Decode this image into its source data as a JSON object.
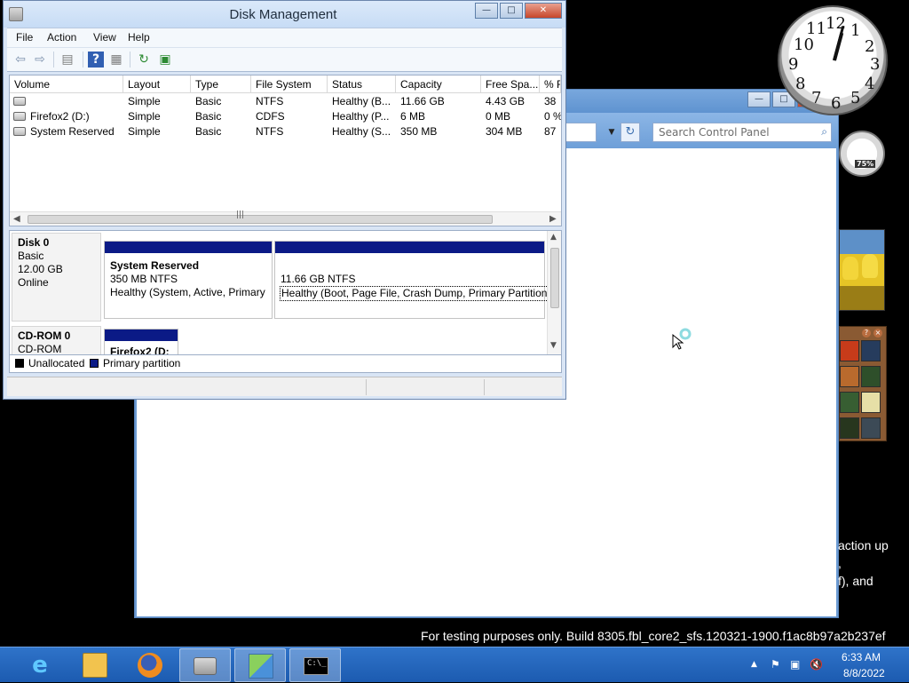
{
  "desktop": {
    "watermark": "For testing purposes only. Build 8305.fbl_core2_sfs.120321-1900.f1ac8b97a2b237ef",
    "overflow_text": [
      "action up",
      ",",
      "f), and"
    ],
    "clock_numbers": [
      "12",
      "1",
      "2",
      "3",
      "4",
      "5",
      "6",
      "7",
      "8",
      "9",
      "10",
      "11"
    ],
    "meter_value": "75%"
  },
  "control_panel": {
    "search_placeholder": "Search Control Panel",
    "title_buttons": [
      "—",
      "□",
      "✕"
    ]
  },
  "disk_management": {
    "title": "Disk Management",
    "menu": [
      "File",
      "Action",
      "View",
      "Help"
    ],
    "toolbar_icons": [
      "back-icon",
      "forward-icon",
      "console-tree-icon",
      "help-icon",
      "properties-icon",
      "refresh-icon",
      "export-icon"
    ],
    "columns": [
      "Volume",
      "Layout",
      "Type",
      "File System",
      "Status",
      "Capacity",
      "Free Spa...",
      "% F"
    ],
    "rows": [
      {
        "volume": "",
        "layout": "Simple",
        "type": "Basic",
        "fs": "NTFS",
        "status": "Healthy (B...",
        "capacity": "11.66 GB",
        "free": "4.43 GB",
        "pct": "38"
      },
      {
        "volume": "Firefox2 (D:)",
        "layout": "Simple",
        "type": "Basic",
        "fs": "CDFS",
        "status": "Healthy (P...",
        "capacity": "6 MB",
        "free": "0 MB",
        "pct": "0 %"
      },
      {
        "volume": "System Reserved",
        "layout": "Simple",
        "type": "Basic",
        "fs": "NTFS",
        "status": "Healthy (S...",
        "capacity": "350 MB",
        "free": "304 MB",
        "pct": "87"
      }
    ],
    "disks": [
      {
        "name": "Disk 0",
        "kind": "Basic",
        "size": "12.00 GB",
        "state": "Online",
        "partitions": [
          {
            "title": "System Reserved",
            "line1": "350 MB NTFS",
            "line2": "Healthy (System, Active, Primary"
          },
          {
            "title": "",
            "line1": "11.66 GB NTFS",
            "line2": "Healthy (Boot, Page File, Crash Dump, Primary Partition)"
          }
        ]
      },
      {
        "name": "CD-ROM 0",
        "kind": "CD-ROM",
        "partitions": [
          {
            "title": "Firefox2 (D:"
          }
        ]
      }
    ],
    "legend": [
      "Unallocated",
      "Primary partition"
    ],
    "colors": {
      "unallocated": "#000000",
      "primary": "#0b1a86"
    }
  },
  "taskbar": {
    "apps": [
      "internet-explorer-icon",
      "file-explorer-icon",
      "firefox-icon",
      "disk-management-icon",
      "control-panel-icon",
      "command-prompt-icon"
    ],
    "time": "6:33 AM",
    "date": "8/8/2022"
  }
}
